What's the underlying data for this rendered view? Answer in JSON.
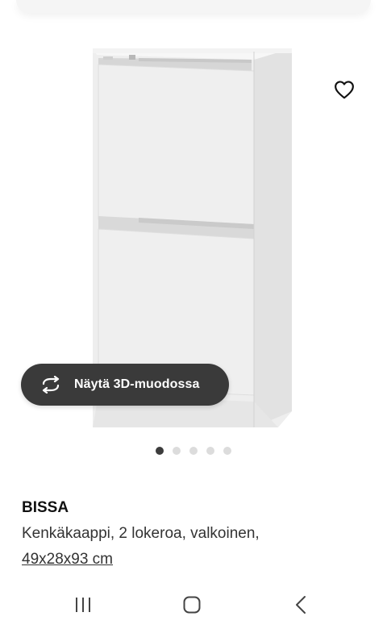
{
  "gallery": {
    "image_icon": "shoe-cabinet-product-image",
    "favourite_icon": "heart-outline-icon",
    "view_3d_label": "Näytä 3D-muodossa",
    "view_3d_icon": "rotate-arrows-icon",
    "image_count": 5,
    "active_image_index": 0
  },
  "product": {
    "name": "BISSA",
    "description": "Kenkäkaappi, 2 lokeroa, valkoinen,",
    "size": "49x28x93 cm"
  },
  "navbar": {
    "recents_icon": "recent-apps-icon",
    "home_icon": "home-icon",
    "back_icon": "back-chevron-icon"
  },
  "colors": {
    "view_3d_background": "#3a3a3a",
    "active_dot": "#3c3c3c",
    "inactive_dot": "#dcdcdc"
  }
}
